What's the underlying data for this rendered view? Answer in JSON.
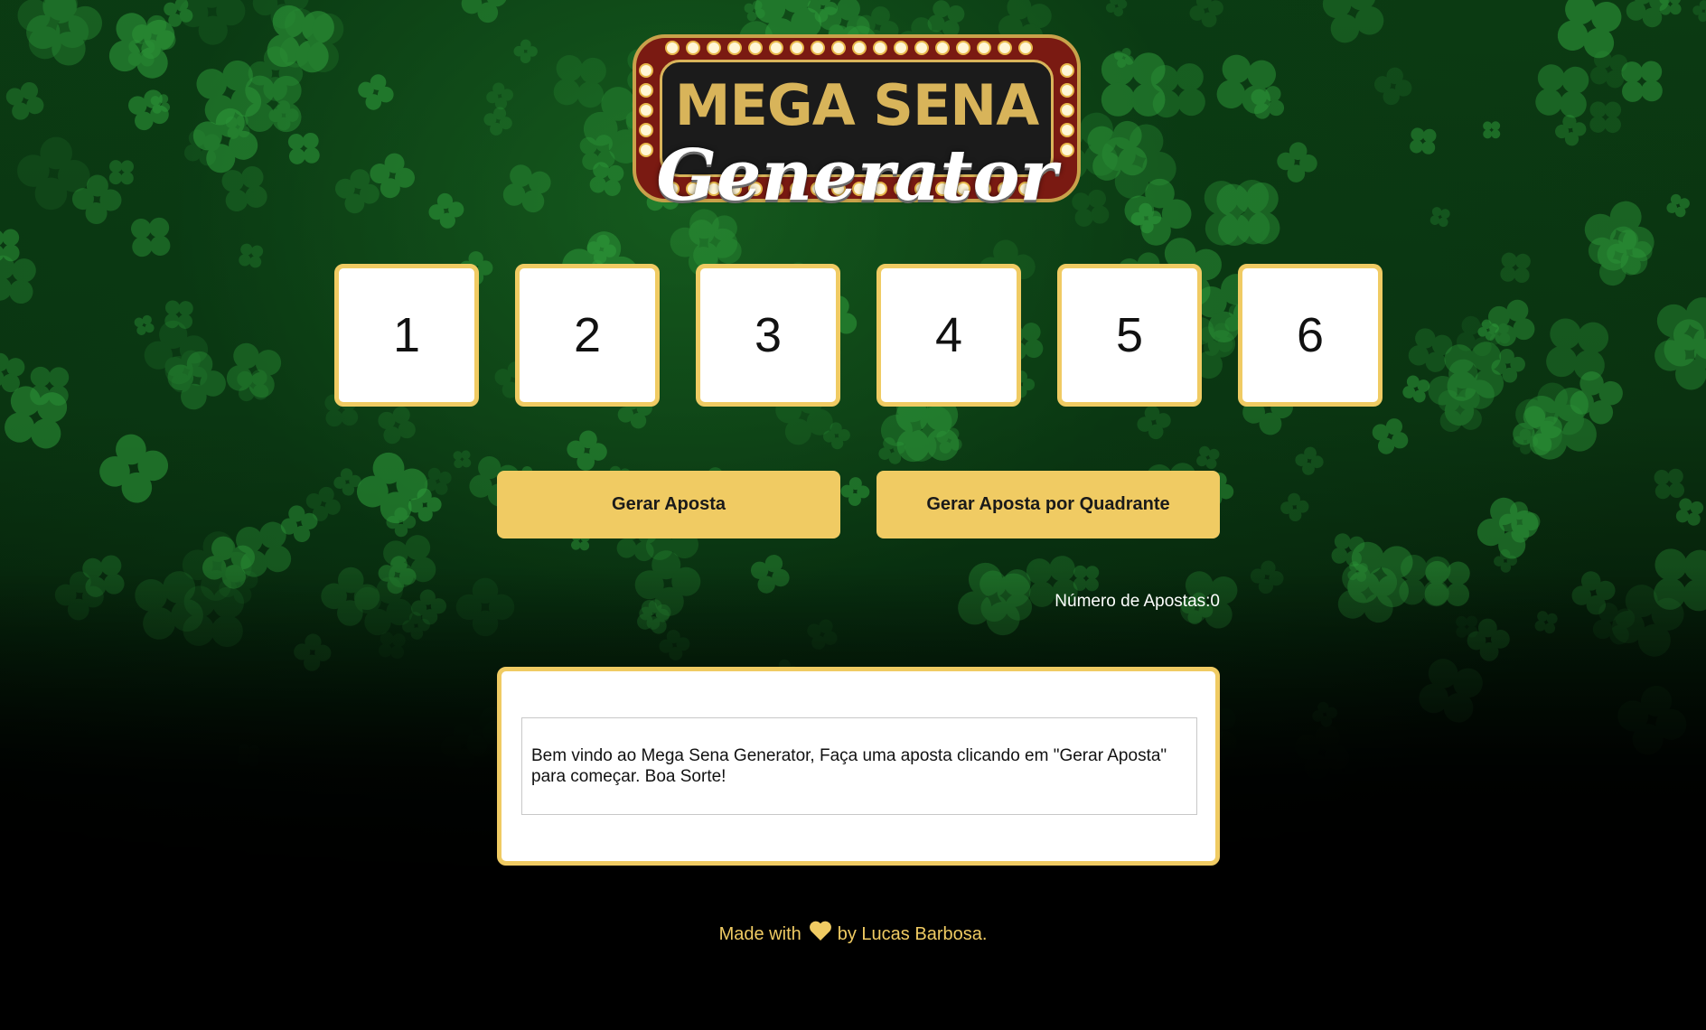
{
  "logo": {
    "title": "MEGA SENA",
    "subtitle": "Generator"
  },
  "numbers": [
    "1",
    "2",
    "3",
    "4",
    "5",
    "6"
  ],
  "actions": {
    "generate_label": "Gerar Aposta",
    "generate_quadrant_label": "Gerar Aposta por Quadrante"
  },
  "stats": {
    "bets_count_text": "Número de Apostas:0"
  },
  "result": {
    "message": "Bem vindo ao Mega Sena Generator, Faça uma aposta clicando em \"Gerar Aposta\" para começar. Boa Sorte!"
  },
  "footer": {
    "prefix": "Made with",
    "icon": "heart-icon",
    "suffix": "by Lucas Barbosa."
  },
  "colors": {
    "accent": "#f0cb63",
    "background": "#000000",
    "clover": "#2e9a3a"
  }
}
